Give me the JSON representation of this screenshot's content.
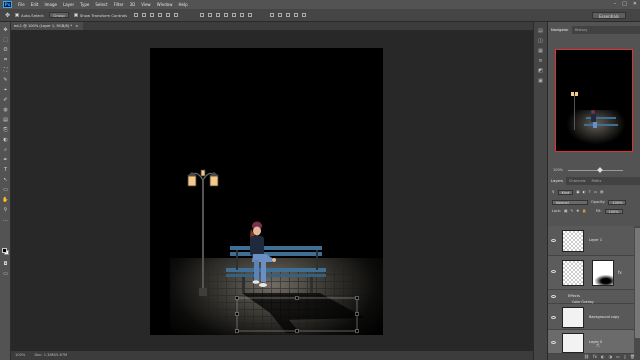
{
  "app": {
    "logo": "Ps"
  },
  "menu": [
    "File",
    "Edit",
    "Image",
    "Layer",
    "Type",
    "Select",
    "Filter",
    "3D",
    "View",
    "Window",
    "Help"
  ],
  "window_controls": [
    "–",
    "□",
    "✕"
  ],
  "options_bar": {
    "auto_select_label": "Auto-Select:",
    "auto_select_target": "Group",
    "transform_controls_label": "Show Transform Controls",
    "workspace": "Essentials"
  },
  "document_tab": {
    "title": "ed-1 @ 100% (Layer 1, RGB/8) *",
    "close": "×"
  },
  "status_bar": {
    "zoom": "100%",
    "doc_info": "Doc: 1.38M/5.67M"
  },
  "navigator": {
    "tabs": [
      "Navigator",
      "History"
    ],
    "zoom": "100%"
  },
  "layers_panel": {
    "tabs": [
      "Layers",
      "Channels",
      "Paths"
    ],
    "filter": "Kind",
    "blend_mode": "Normal",
    "opacity_label": "Opacity:",
    "opacity": "100%",
    "lock_label": "Lock:",
    "fill_label": "Fill:",
    "fill": "100%",
    "layers": [
      {
        "name": "Layer 1"
      },
      {
        "name": "Effects"
      },
      {
        "name": "Color Overlay"
      },
      {
        "name": "Background copy"
      },
      {
        "name": "Layer 0"
      }
    ],
    "footer_icons": [
      "⛓",
      "fx",
      "◐",
      "◑",
      "▭",
      "▯",
      "🗑"
    ]
  },
  "tools": [
    "✥",
    "⬚",
    "ʘ",
    "⌗",
    "⛶",
    "✎",
    "⌖",
    "✐",
    "◍",
    "▤",
    "⎘",
    "◐",
    "⌕",
    "✒",
    "T",
    "↖",
    "▭",
    "✋",
    "⚲",
    "…"
  ],
  "panel_strip_icons": [
    "▤",
    "◫",
    "▦",
    "≡",
    "◩",
    "▣"
  ]
}
